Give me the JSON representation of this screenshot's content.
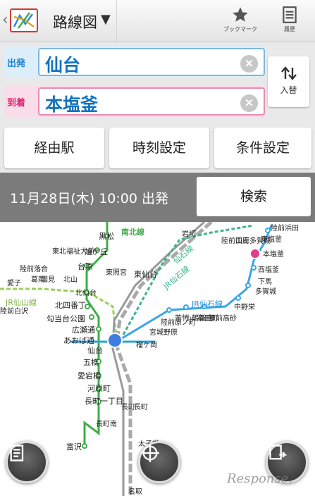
{
  "header": {
    "title": "路線図",
    "bookmark_label": "ブックマーク",
    "history_label": "履歴"
  },
  "route": {
    "from_label": "出発",
    "from_value": "仙台",
    "to_label": "到着",
    "to_value": "本塩釜",
    "swap_label": "入替",
    "clear_glyph": "×"
  },
  "options": {
    "via": "経由駅",
    "time": "時刻設定",
    "conditions": "条件設定"
  },
  "search": {
    "datetime": "11月28日(木) 10:00 出発",
    "button": "検索"
  },
  "map": {
    "line_labels": [
      "南北線",
      "仙石線",
      "JR仙山線",
      "JR仙石線",
      "JR仙石線"
    ],
    "stations": [
      "黒松",
      "旭ケ丘",
      "台原",
      "北仙台",
      "北四番丁",
      "勾当台公園",
      "広瀬通",
      "あおば通",
      "仙台",
      "五橋",
      "愛宕橋",
      "河原町",
      "長町一丁目",
      "長町",
      "長町",
      "長町南",
      "富沢",
      "東照宮",
      "東仙台",
      "東北福祉大前",
      "北山",
      "国見",
      "葛岡",
      "陸前落合",
      "愛子",
      "陸前白沢",
      "榴ケ岡",
      "宮城野原",
      "陸前原ノ町",
      "苦竹",
      "小鶴新田",
      "福田町",
      "陸前高砂",
      "中野栄",
      "多賀城",
      "下馬",
      "西塩釜",
      "本塩釜",
      "東塩釜",
      "陸前浜田",
      "国府多賀城",
      "陸前山王",
      "岩切",
      "太子堂",
      "名取"
    ],
    "watermark": "Response."
  }
}
